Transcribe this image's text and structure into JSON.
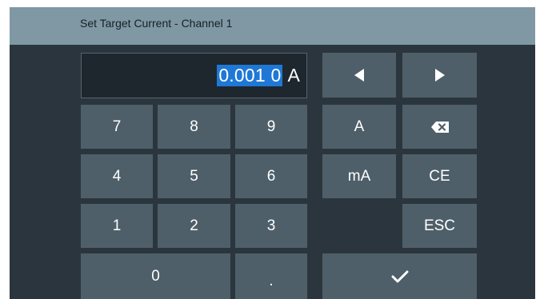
{
  "dialog": {
    "title": "Set Target Current - Channel 1"
  },
  "display": {
    "selected_value": "0.001 0",
    "unit": "A"
  },
  "keypad": {
    "k7": "7",
    "k8": "8",
    "k9": "9",
    "k4": "4",
    "k5": "5",
    "k6": "6",
    "k1": "1",
    "k2": "2",
    "k3": "3",
    "k0": "0",
    "dot": "."
  },
  "function_keys": {
    "unit_a": "A",
    "unit_ma": "mA",
    "clear_entry": "CE",
    "escape": "ESC"
  },
  "icons": {
    "left": "arrow-left-icon",
    "right": "arrow-right-icon",
    "backspace": "backspace-icon",
    "enter": "checkmark-icon"
  },
  "colors": {
    "title_bar": "#7f98a4",
    "background": "#2b353d",
    "key": "#4f5f69",
    "selection": "#1f78d6"
  }
}
